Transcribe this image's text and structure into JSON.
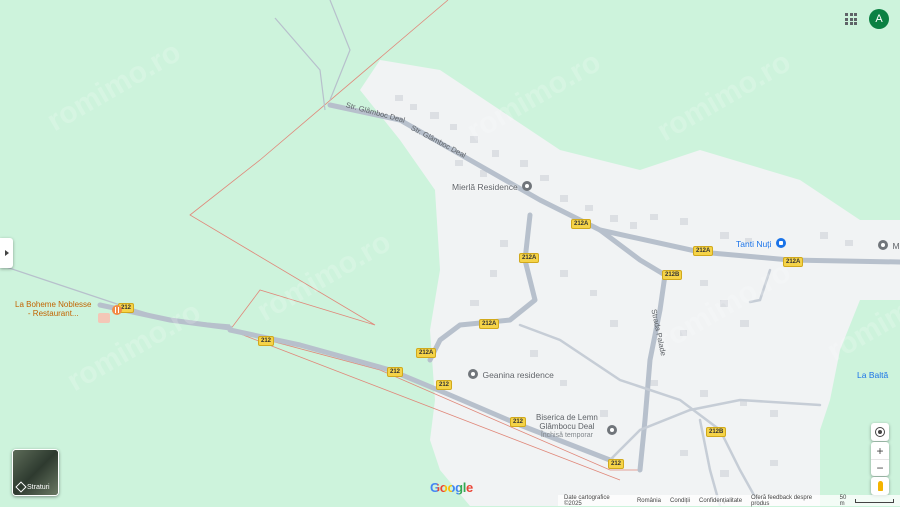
{
  "watermark": "romimo.ro",
  "roads": {
    "str_glamboc_1": "Str. Glâmboc Deal",
    "str_glamboc_2": "Str. Glâmboc Deal",
    "strada_palade": "Strada Palade"
  },
  "shields": [
    "212A",
    "212A",
    "212A",
    "212A",
    "212A",
    "212A",
    "212B",
    "212B",
    "212",
    "212",
    "212",
    "212",
    "212",
    "212"
  ],
  "places": {
    "mierla": "Mierlă Residence",
    "tanti": "Tanti Nuți",
    "geanina": "Geanina residence",
    "biserica_1": "Biserica de Lemn",
    "biserica_2": "Glâmbocu Deal",
    "biserica_status": "Închisă temporar",
    "boheme_1": "La Boheme Noblesse",
    "boheme_2": "- Restaurant...",
    "la_balta": "La Baltă",
    "m_cut": "M"
  },
  "controls": {
    "apps_icon": "apps-grid-icon",
    "avatar": "A",
    "layers_label": "Straturi",
    "zoom_in": "+",
    "zoom_out": "−"
  },
  "google_logo": "Google",
  "footer": {
    "data": "Date cartografice ©2025",
    "country": "România",
    "terms": "Condiții",
    "privacy": "Confidențialitate",
    "feedback": "Oferă feedback despre produs",
    "scale": "50 m"
  },
  "colors": {
    "green": "#cdf3dc",
    "built_area": "#f1f3f4",
    "road": "#b7c0cc",
    "boundary": "#e0887a",
    "accent_blue": "#1a73e8",
    "restaurant_orange": "#f28b45",
    "avatar_green": "#0b8043"
  }
}
